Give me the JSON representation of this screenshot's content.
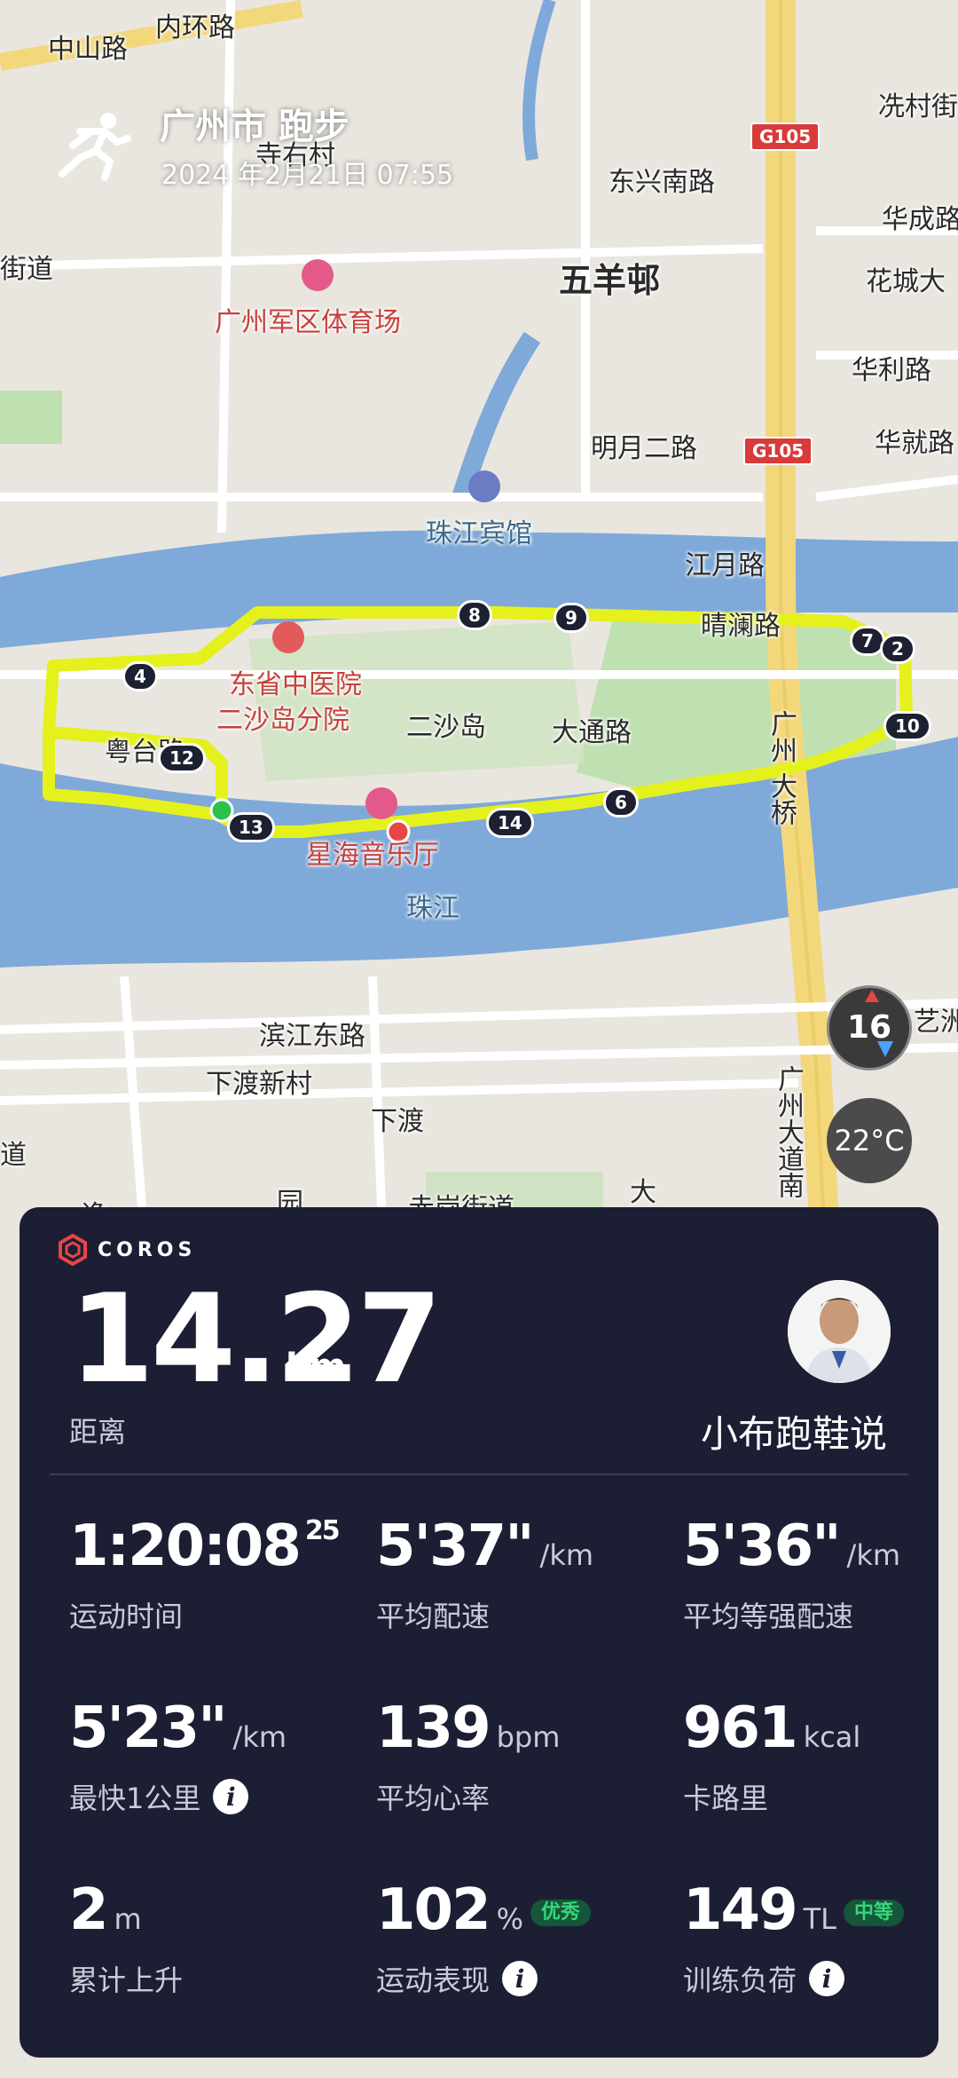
{
  "header": {
    "title": "广州市 跑步",
    "date": "2024 年2月21日 07:55",
    "icon": "runner-icon"
  },
  "map": {
    "labels": {
      "zhongshan": "中山路",
      "neihuan": "内环路",
      "siyou": "寺右村",
      "xiancun": "冼村街",
      "jiedao": "街道",
      "dongxing": "东兴南路",
      "huacheng": "华成路",
      "wuyangcun": "五羊邨",
      "huachengda": "花城大",
      "tiyuchang": "广州军区体育场",
      "huali": "华利路",
      "mingyue": "明月二路",
      "huajiu": "华就路",
      "binguan": "珠江宾馆",
      "jiangyue": "江月路",
      "qingbo": "晴澜路",
      "hospital1": "东省中医院",
      "hospital2": "二沙岛分院",
      "ershadao": "二沙岛",
      "datong": "大通路",
      "guangzhou": "广州",
      "daqiao": "大桥",
      "yutai": "粤台路",
      "xinghai": "星海音乐厅",
      "zhujiang": "珠江",
      "binjiang": "滨江东路",
      "xiadu_village": "下渡新村",
      "xiadu": "下渡",
      "zhizhou": "艺洲",
      "gzdadao": "广州大道南",
      "dao2": "道",
      "yuan": "园",
      "chigang": "赤岗街道",
      "da": "大",
      "yi": "逸"
    },
    "road_shield": "G105",
    "markers": [
      "4",
      "8",
      "9",
      "7",
      "2",
      "10",
      "12",
      "13",
      "14",
      "6"
    ],
    "compass_value": "16",
    "temperature": "22°C"
  },
  "card": {
    "brand": "COROS",
    "distance": {
      "value": "14.27",
      "unit": "km",
      "label": "距离"
    },
    "user_name": "小布跑鞋说",
    "stats": {
      "time": {
        "value": "1:20:08",
        "sub": "25",
        "label": "运动时间"
      },
      "avg_pace": {
        "value": "5'37\"",
        "unit": "/km",
        "label": "平均配速"
      },
      "grade_pace": {
        "value": "5'36\"",
        "unit": "/km",
        "label": "平均等强配速"
      },
      "fastest_km": {
        "value": "5'23\"",
        "unit": "/km",
        "label": "最快1公里"
      },
      "avg_hr": {
        "value": "139",
        "unit": "bpm",
        "label": "平均心率"
      },
      "calories": {
        "value": "961",
        "unit": "kcal",
        "label": "卡路里"
      },
      "ascent": {
        "value": "2",
        "unit": "m",
        "label": "累计上升"
      },
      "performance": {
        "value": "102",
        "unit": "%",
        "badge": "优秀",
        "label": "运动表现"
      },
      "training_load": {
        "value": "149",
        "unit": "TL",
        "badge": "中等",
        "label": "训练负荷"
      }
    }
  },
  "colors": {
    "route": "#e5f11d",
    "card_bg": "#1c1f33",
    "river": "#7ea9d8",
    "badge_green": "#36d67a"
  }
}
